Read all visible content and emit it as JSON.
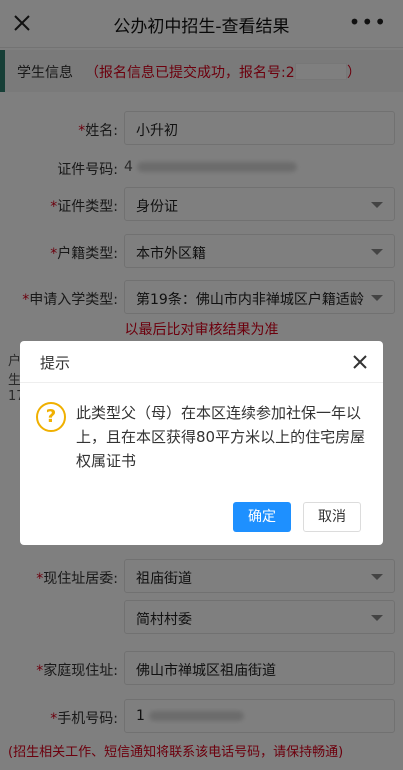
{
  "nav": {
    "title": "公办初中招生-查看结果",
    "more": "•••"
  },
  "section": {
    "label": "学生信息",
    "status_prefix": "（报名信息已提交成功，报名号:2",
    "status_suffix": "）"
  },
  "form": {
    "name_label": "姓名:",
    "name_value": "小升初",
    "id_label": "证件号码:",
    "id_value_prefix": "4",
    "id_type_label": "证件类型:",
    "id_type_value": "身份证",
    "hukou_label": "户籍类型:",
    "hukou_value": "本市外区籍",
    "apply_type_label": "申请入学类型:",
    "apply_type_value": "第19条：佛山市内非禅城区户籍适龄",
    "verify_note": "以最后比对审核结果为准",
    "left_frag_1": "户",
    "left_frag_2": "生",
    "left_frag_3": "17",
    "residence_label": "现住址居委:",
    "residence_value": "祖庙街道",
    "village_value": "简村村委",
    "address_label": "家庭现住址:",
    "address_value": "佛山市禅城区祖庙街道",
    "phone_label": "手机号码:",
    "phone_value": "1",
    "bottom_tip": "(招生相关工作、短信通知将联系该电话号码，请保持畅通)"
  },
  "dialog": {
    "title": "提示",
    "icon": "?",
    "message": "此类型父（母）在本区连续参加社保一年以上，且在本区获得80平方米以上的住宅房屋权属证书",
    "ok_label": "确定",
    "cancel_label": "取消"
  }
}
